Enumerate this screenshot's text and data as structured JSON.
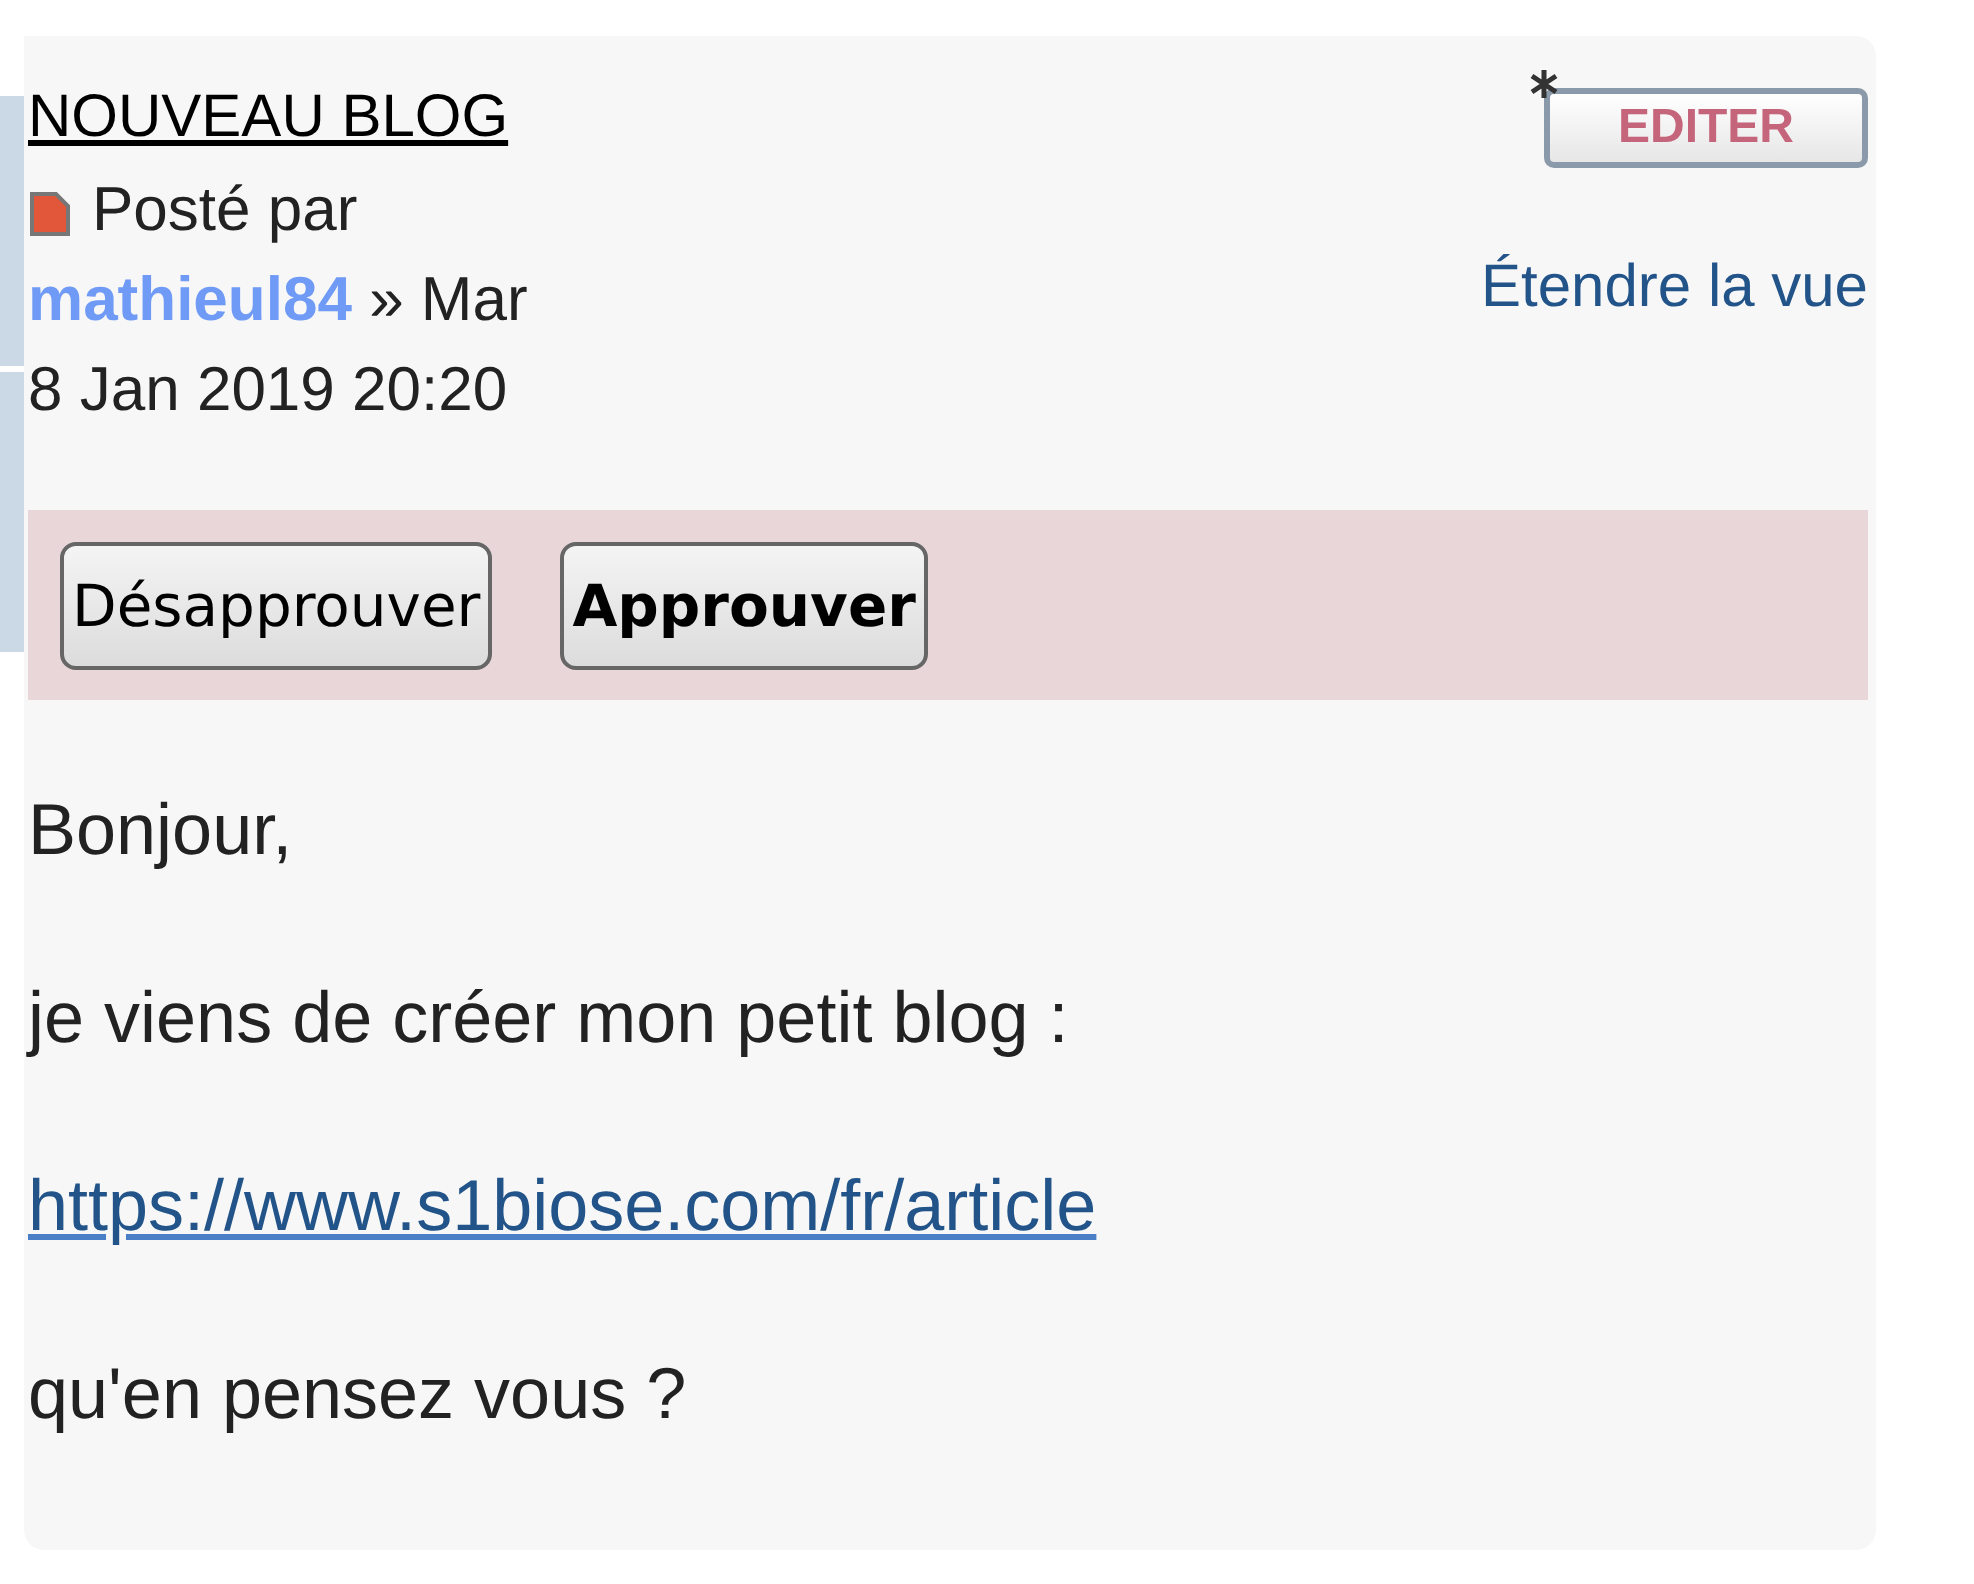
{
  "post": {
    "title": "NOUVEAU BLOG",
    "posted_by": "Posté par",
    "author": "mathieul84",
    "date_sep": "»",
    "date_weekday": "Mar",
    "date": "8 Jan 2019 20:20",
    "edit_button": "EDITER",
    "expand_link": "Étendre la vue"
  },
  "moderation": {
    "buttons": [
      {
        "label": "Désapprouver",
        "primary": false
      },
      {
        "label": "Approuver",
        "primary": true
      }
    ]
  },
  "body": [
    {
      "kind": "text",
      "text": "Bonjour,"
    },
    {
      "kind": "text",
      "text": "je viens de créer mon petit blog :"
    },
    {
      "kind": "link",
      "text": "https://www.s1biose.com/fr/article"
    },
    {
      "kind": "text",
      "text": "qu'en pensez vous ?"
    }
  ]
}
